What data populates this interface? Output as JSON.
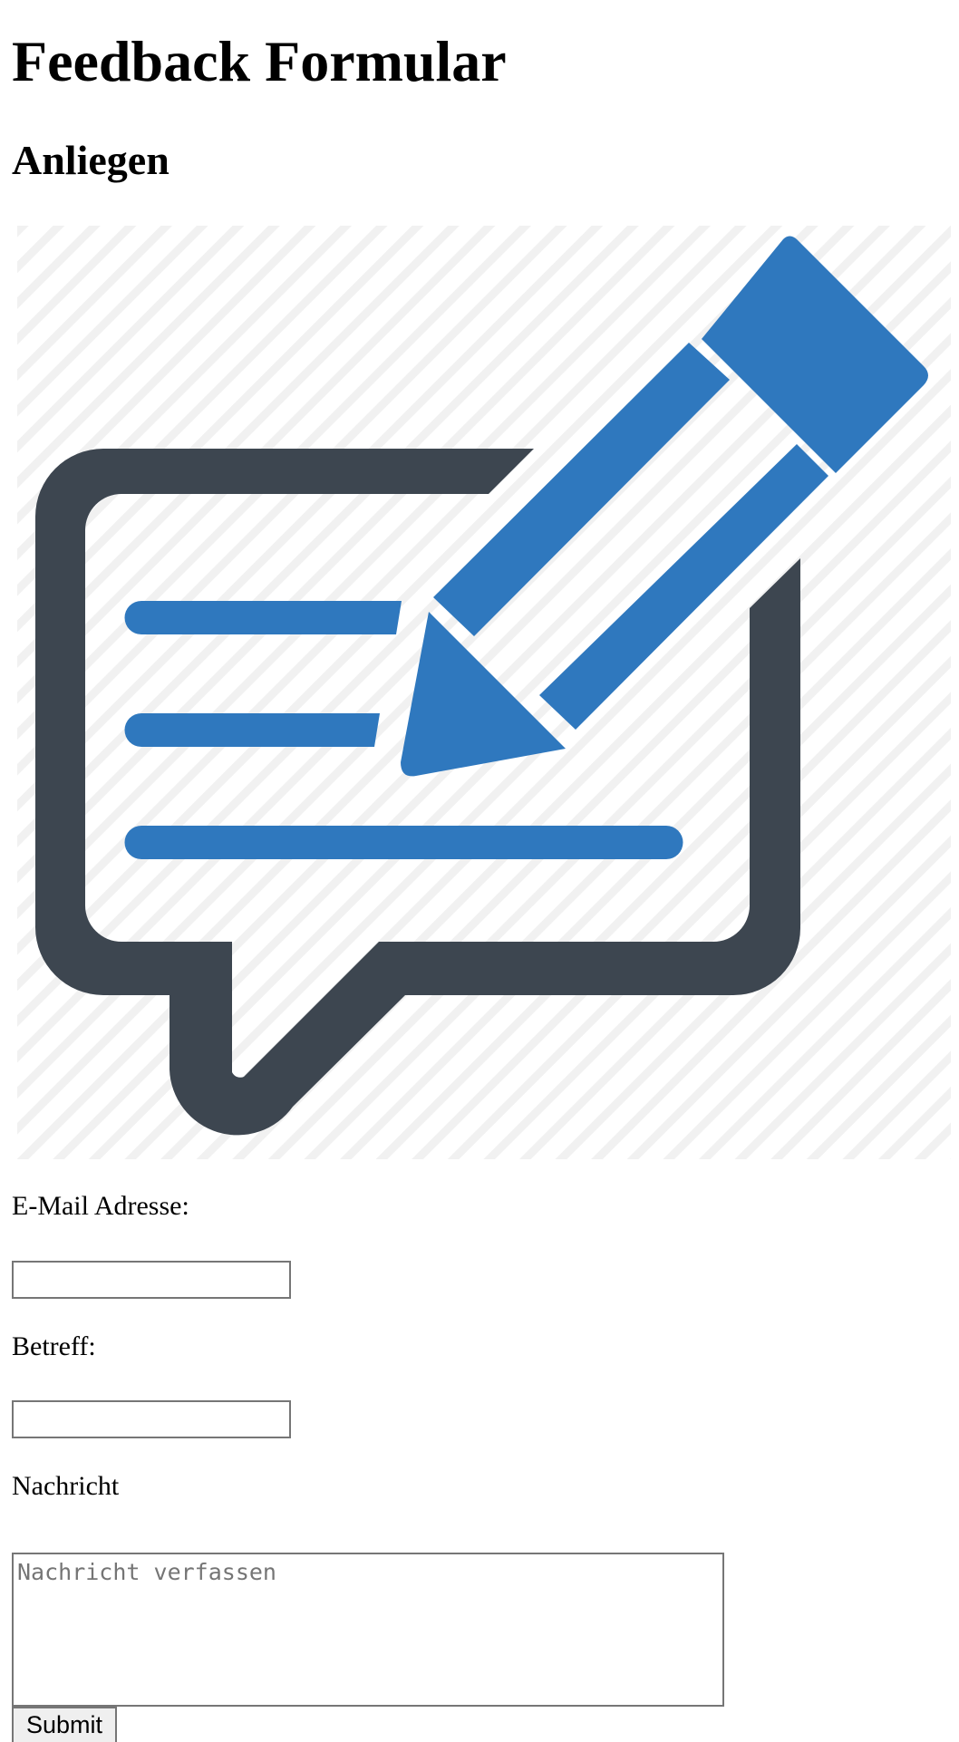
{
  "page": {
    "title": "Feedback Formular",
    "subtitle": "Anliegen"
  },
  "hero": {
    "icon": "feedback-speech-bubble-pencil-icon",
    "colors": {
      "bubble": "#3d4650",
      "pencil": "#2f78be",
      "stripes": "#f2f2f2"
    }
  },
  "form": {
    "email_label": "E-Mail Adresse:",
    "email_value": "",
    "subject_label": "Betreff:",
    "subject_value": "",
    "message_label": "Nachricht",
    "message_placeholder": "Nachricht verfassen",
    "submit_label": "Submit"
  }
}
